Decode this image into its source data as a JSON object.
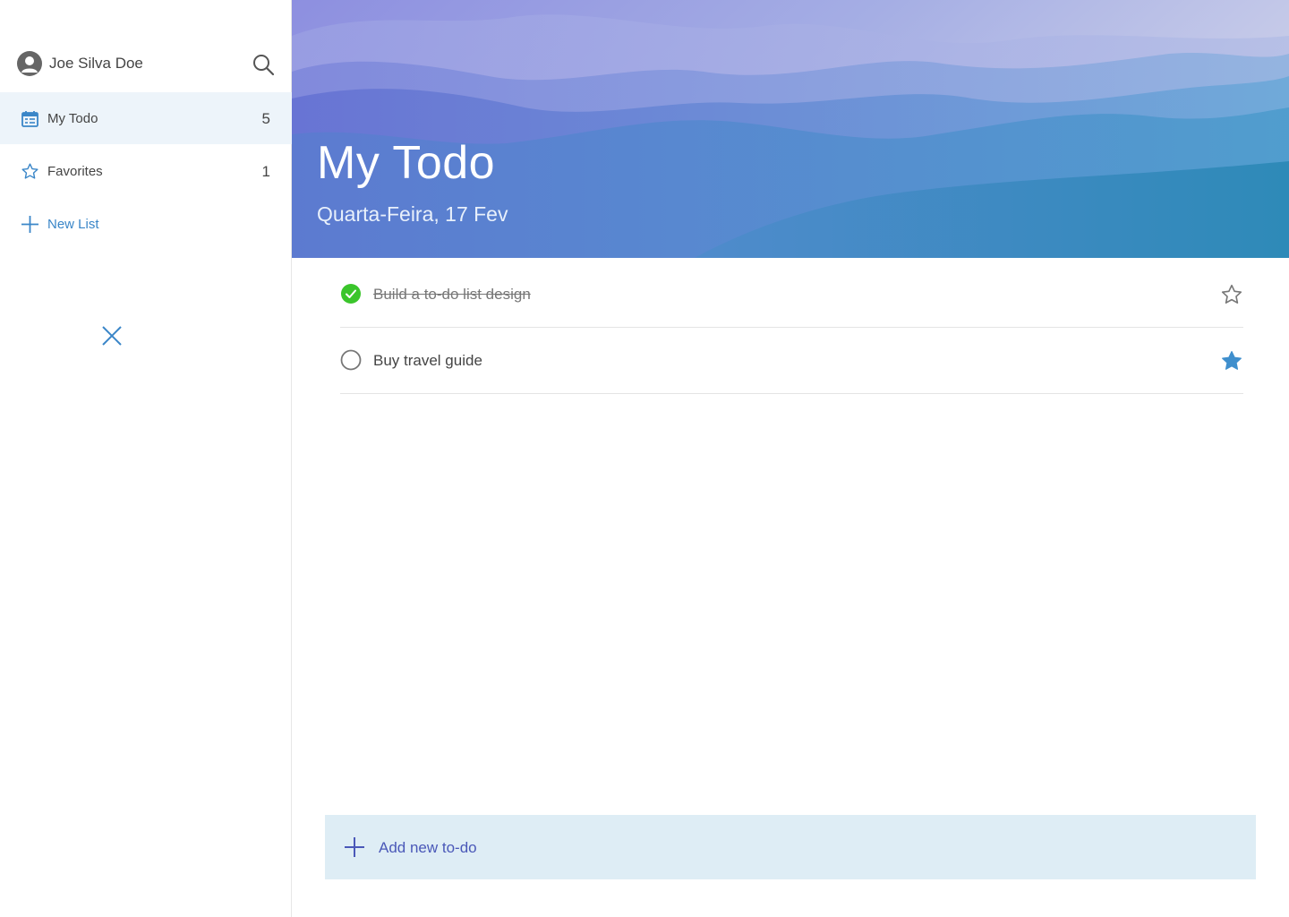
{
  "user": {
    "name": "Joe Silva Doe",
    "avatar_icon": "user-avatar-icon"
  },
  "search": {
    "icon": "search-icon"
  },
  "sidebar": {
    "items": [
      {
        "label": "My Todo",
        "count": "5",
        "icon": "calendar-icon",
        "active": true
      },
      {
        "label": "Favorites",
        "count": "1",
        "icon": "star-outline-icon",
        "active": false
      }
    ],
    "new_list": {
      "label": "New List",
      "icon": "plus-icon"
    },
    "close_icon": "close-icon"
  },
  "header": {
    "title": "My Todo",
    "date": "Quarta-Feira, 17 Fev"
  },
  "todos": [
    {
      "text": "Build a to-do list design",
      "completed": true,
      "favorite": false
    },
    {
      "text": "Buy travel guide",
      "completed": false,
      "favorite": true
    }
  ],
  "add_todo": {
    "label": "Add new to-do",
    "icon": "plus-icon"
  },
  "colors": {
    "accent": "#3a86c8",
    "check_done": "#3ac52b",
    "star_filled": "#3f8fcd",
    "add_bar_bg": "#deedf5",
    "add_text": "#4a58b8",
    "active_nav_bg": "#edf4fa"
  }
}
